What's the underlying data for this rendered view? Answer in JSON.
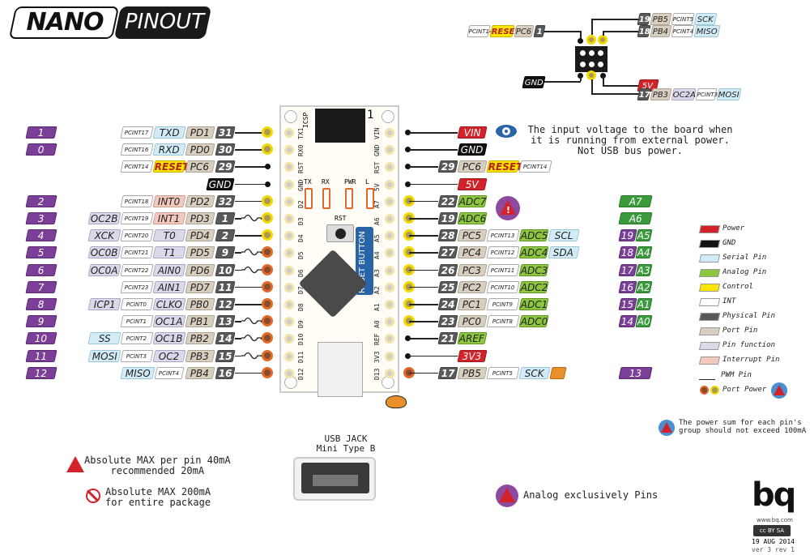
{
  "title": {
    "left": "NANO",
    "right": "PINOUT"
  },
  "icsp": {
    "top_right": [
      {
        "phys": "19",
        "port": "PB5",
        "int": "PCINT5",
        "func": "SCK"
      },
      {
        "phys": "18",
        "port": "PB4",
        "int": "PCINT4",
        "func": "MISO"
      }
    ],
    "top_left": {
      "int": "PCINT14",
      "ctrl": "RESET",
      "port": "PC6",
      "phys": "1"
    },
    "bottom_left": {
      "gnd": "GND"
    },
    "bottom_right_power": "5V",
    "bottom_right": {
      "phys": "17",
      "port": "PB3",
      "func": "OC2A",
      "int": "PCINT3",
      "ser": "MOSI"
    }
  },
  "left_pins": [
    {
      "ard": "1",
      "extra": "",
      "int": "PCINT17",
      "func": "TXD",
      "ftype": "ser",
      "port": "PD1",
      "phys": "31",
      "pin": "yellow",
      "pwm": false
    },
    {
      "ard": "0",
      "extra": "",
      "int": "PCINT16",
      "func": "RXD",
      "ftype": "ser",
      "port": "PD0",
      "phys": "30",
      "pin": "yellow",
      "pwm": false
    },
    {
      "ard": "",
      "extra": "",
      "int": "PCINT14",
      "func": "RESET",
      "ftype": "ctrl",
      "port": "PC6",
      "phys": "29",
      "pin": "dot",
      "pwm": false
    },
    {
      "ard": "",
      "extra": "",
      "int": "",
      "func": "",
      "ftype": "",
      "port": "",
      "phys": "",
      "gnd": "GND",
      "pin": "dot",
      "pwm": false
    },
    {
      "ard": "2",
      "extra": "",
      "int": "PCINT18",
      "func": "INT0",
      "ftype": "irq",
      "port": "PD2",
      "phys": "32",
      "pin": "yellow",
      "pwm": false
    },
    {
      "ard": "3",
      "extra": "OC2B",
      "int": "PCINT19",
      "func": "INT1",
      "ftype": "irq",
      "port": "PD3",
      "phys": "1",
      "pin": "yellow",
      "pwm": true
    },
    {
      "ard": "4",
      "extra": "XCK",
      "int": "PCINT20",
      "func": "T0",
      "ftype": "func",
      "port": "PD4",
      "phys": "2",
      "pin": "yellow",
      "pwm": false
    },
    {
      "ard": "5",
      "extra": "OC0B",
      "int": "PCINT21",
      "func": "T1",
      "ftype": "func",
      "port": "PD5",
      "phys": "9",
      "pin": "orange",
      "pwm": true
    },
    {
      "ard": "6",
      "extra": "OC0A",
      "int": "PCINT22",
      "func": "AIN0",
      "ftype": "func",
      "port": "PD6",
      "phys": "10",
      "pin": "orange",
      "pwm": true
    },
    {
      "ard": "7",
      "extra": "",
      "int": "PCINT23",
      "func": "AIN1",
      "ftype": "func",
      "port": "PD7",
      "phys": "11",
      "pin": "orange",
      "pwm": false
    },
    {
      "ard": "8",
      "extra": "ICP1",
      "int": "PCINT0",
      "func": "CLKO",
      "ftype": "func",
      "port": "PB0",
      "phys": "12",
      "pin": "orange",
      "pwm": false
    },
    {
      "ard": "9",
      "extra": "",
      "int": "PCINT1",
      "func": "OC1A",
      "ftype": "func",
      "port": "PB1",
      "phys": "13",
      "pin": "orange",
      "pwm": true
    },
    {
      "ard": "10",
      "extra": "SS",
      "extratype": "ser",
      "int": "PCINT2",
      "func": "OC1B",
      "ftype": "func",
      "port": "PB2",
      "phys": "14",
      "pin": "orange",
      "pwm": true
    },
    {
      "ard": "11",
      "extra": "MOSI",
      "extratype": "ser",
      "int": "PCINT3",
      "func": "OC2",
      "ftype": "func",
      "port": "PB3",
      "phys": "15",
      "pin": "orange",
      "pwm": true
    },
    {
      "ard": "12",
      "extra": "",
      "int": "PCINT4",
      "func": "MISO",
      "ftype": "ser",
      "port": "PB4",
      "phys": "16",
      "pin": "orange",
      "pwm": false,
      "swap": true
    }
  ],
  "right_pins": [
    {
      "power": "VIN",
      "pin": "dot"
    },
    {
      "gnd": "GND",
      "pin": "dot"
    },
    {
      "phys": "29",
      "port": "PC6",
      "ctrl": "RESET",
      "int": "PCINT14",
      "pin": "dot"
    },
    {
      "power": "5V",
      "pin": "dot"
    },
    {
      "phys": "22",
      "ana": "ADC7",
      "pin": "yellow",
      "ard_a": "A7"
    },
    {
      "phys": "19",
      "ana": "ADC6",
      "pin": "yellow",
      "ard_a": "A6"
    },
    {
      "phys": "28",
      "port": "PC5",
      "int": "PCINT13",
      "ana": "ADC5",
      "ser": "SCL",
      "pin": "yellow",
      "ard_d": "19",
      "ard_a": "A5"
    },
    {
      "phys": "27",
      "port": "PC4",
      "int": "PCINT12",
      "ana": "ADC4",
      "ser": "SDA",
      "pin": "yellow",
      "ard_d": "18",
      "ard_a": "A4"
    },
    {
      "phys": "26",
      "port": "PC3",
      "int": "PCINT11",
      "ana": "ADC3",
      "pin": "yellow",
      "ard_d": "17",
      "ard_a": "A3"
    },
    {
      "phys": "25",
      "port": "PC2",
      "int": "PCINT10",
      "ana": "ADC2",
      "pin": "yellow",
      "ard_d": "16",
      "ard_a": "A2"
    },
    {
      "phys": "24",
      "port": "PC1",
      "int": "PCINT9",
      "ana": "ADC1",
      "pin": "yellow",
      "ard_d": "15",
      "ard_a": "A1"
    },
    {
      "phys": "23",
      "port": "PC0",
      "int": "PCINT8",
      "ana": "ADC0",
      "pin": "yellow",
      "ard_d": "14",
      "ard_a": "A0"
    },
    {
      "phys": "21",
      "ana": "AREF",
      "pin": "dot"
    },
    {
      "power": "3V3",
      "pin": "dot"
    },
    {
      "phys": "17",
      "port": "PB5",
      "int": "PCINT5",
      "ser": "SCK",
      "pin": "orange",
      "ard_d": "13",
      "led": true
    }
  ],
  "board": {
    "icsp_label": "ICSP",
    "icsp_one": "1",
    "left_labels": [
      "TX1",
      "RX0",
      "RST",
      "GND",
      "D2",
      "D3",
      "D4",
      "D5",
      "D6",
      "D7",
      "D8",
      "D9",
      "D10",
      "D11",
      "D12"
    ],
    "right_labels": [
      "VIN",
      "GND",
      "RST",
      "5V",
      "A7",
      "A6",
      "A5",
      "A4",
      "A3",
      "A2",
      "A1",
      "A0",
      "REF",
      "3V3",
      "D13"
    ],
    "leds": [
      "TX",
      "RX",
      "PWR",
      "L"
    ],
    "rst_label": "RST",
    "reset_button": "RESET BUTTON"
  },
  "vin_note": "The input voltage to the board when\nit is running from external power.\nNot USB bus power.",
  "legend": [
    {
      "label": "Power",
      "color": "#d2232a"
    },
    {
      "label": "GND",
      "color": "#111111"
    },
    {
      "label": "Serial Pin",
      "color": "#d2ecf7"
    },
    {
      "label": "Analog Pin",
      "color": "#8dc63f"
    },
    {
      "label": "Control",
      "color": "#ffe600"
    },
    {
      "label": "INT",
      "color": "#ffffff"
    },
    {
      "label": "Physical Pin",
      "color": "#58595b"
    },
    {
      "label": "Port Pin",
      "color": "#d9cfc1"
    },
    {
      "label": "Pin function",
      "color": "#d9d9ea"
    },
    {
      "label": "Interrupt Pin",
      "color": "#f3c9bd"
    }
  ],
  "legend_pwm": "PWM Pin",
  "legend_port_power": "Port Power",
  "power_sum_note": "The power sum for each pin's\ngroup should not exceed 100mA",
  "max_pin_note": "Absolute MAX per pin 40mA\nrecommended 20mA",
  "max_pkg_note": "Absolute MAX 200mA\nfor entire package",
  "usb_label": "USB JACK\nMini Type B",
  "analog_note": "Analog exclusively Pins",
  "footer": {
    "brand": "bq",
    "url": "www.bq.com",
    "license": "cc BY SA",
    "date": "19 AUG 2014",
    "version": "ver 3 rev 1"
  }
}
